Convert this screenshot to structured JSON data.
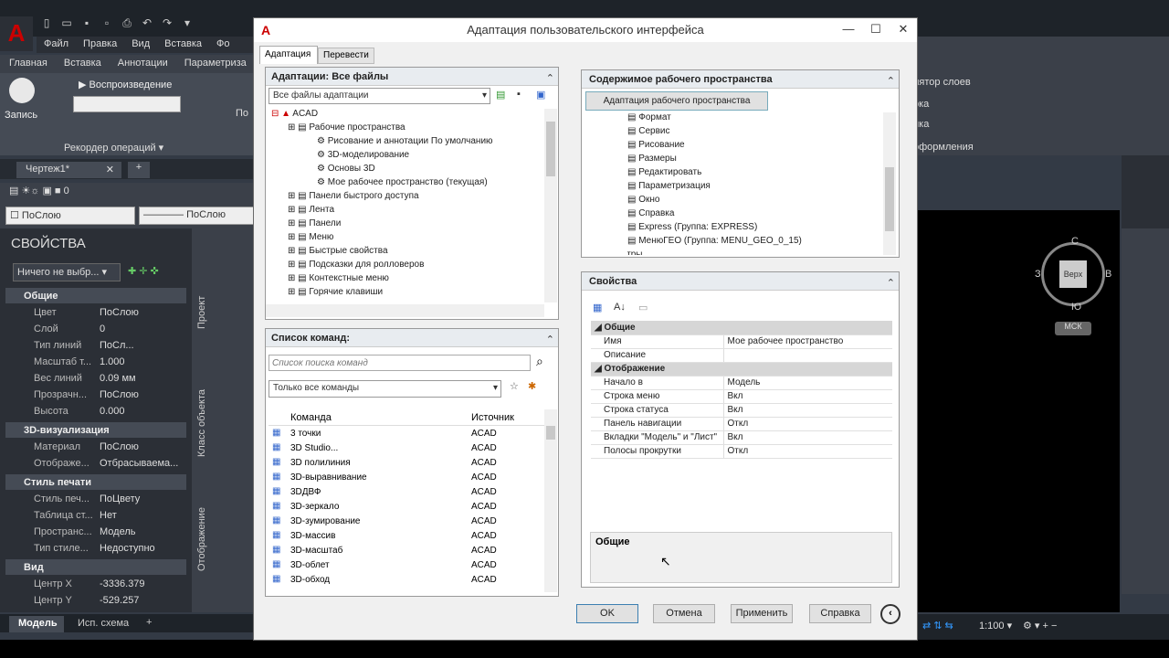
{
  "acad": {
    "menu": [
      "Файл",
      "Правка",
      "Вид",
      "Вставка",
      "Фо"
    ],
    "ribbon_tabs": [
      "Главная",
      "Вставка",
      "Аннотации",
      "Параметриза"
    ],
    "record_label": "Запись",
    "playback": "Воспроизведение",
    "recorder_panel": "Рекордер операций",
    "ribbon_side": "По",
    "doc_tab": "Чертеж1*",
    "layer_value": "0",
    "bylayer1": "ПоСлою",
    "bylayer2": "ПоСлою",
    "properties_title": "СВОЙСТВА",
    "selection": "Ничего не выбр...",
    "sections": {
      "general": "Общие",
      "viz3d": "3D-визуализация",
      "plotstyle": "Стиль печати",
      "view": "Вид"
    },
    "general_rows": [
      {
        "k": "Цвет",
        "v": "ПоСлою"
      },
      {
        "k": "Слой",
        "v": "0"
      },
      {
        "k": "Тип линий",
        "v": "ПоСл..."
      },
      {
        "k": "Масштаб т...",
        "v": "1.000"
      },
      {
        "k": "Вес линий",
        "v": "0.09 мм"
      },
      {
        "k": "Прозрачн...",
        "v": "ПоСлою"
      },
      {
        "k": "Высота",
        "v": "0.000"
      }
    ],
    "viz_rows": [
      {
        "k": "Материал",
        "v": "ПоСлою"
      },
      {
        "k": "Отображе...",
        "v": "Отбрасываема..."
      }
    ],
    "plot_rows": [
      {
        "k": "Стиль печ...",
        "v": "ПоЦвету"
      },
      {
        "k": "Таблица ст...",
        "v": "Нет"
      },
      {
        "k": "Прострaнс...",
        "v": "Модель"
      },
      {
        "k": "Тип стиле...",
        "v": "Недоступно"
      }
    ],
    "view_rows": [
      {
        "k": "Центр X",
        "v": "-3336.379"
      },
      {
        "k": "Центр Y",
        "v": "-529.257"
      }
    ],
    "side_labels": [
      "Проект",
      "Класс объекта",
      "Отображение"
    ],
    "status_tabs": [
      "Модель",
      "Исп. схема"
    ],
    "right_menu": [
      "лятор слоев",
      "рка",
      "йка",
      "оформления"
    ],
    "viewcube": {
      "top": "Верх",
      "n": "С",
      "s": "Ю",
      "w": "З",
      "e": "В",
      "ucs": "МСК"
    },
    "scale": "1:100"
  },
  "dialog": {
    "title": "Адаптация пользовательского интерфейса",
    "tabs": [
      "Адаптация",
      "Перевести"
    ],
    "left_top": {
      "header": "Адаптации: Все файлы",
      "combo": "Все файлы адаптации",
      "tree": [
        {
          "lvl": 0,
          "text": "ACAD"
        },
        {
          "lvl": 1,
          "text": "Рабочие пространства"
        },
        {
          "lvl": 2,
          "text": "Рисование и аннотации По умолчанию"
        },
        {
          "lvl": 2,
          "text": "3D-моделирование"
        },
        {
          "lvl": 2,
          "text": "Основы 3D"
        },
        {
          "lvl": 2,
          "text": "Мое рабочее пространство (текущая)"
        },
        {
          "lvl": 1,
          "text": "Панели быстрого доступа"
        },
        {
          "lvl": 1,
          "text": "Лента"
        },
        {
          "lvl": 1,
          "text": "Панели"
        },
        {
          "lvl": 1,
          "text": "Меню"
        },
        {
          "lvl": 1,
          "text": "Быстрые свойства"
        },
        {
          "lvl": 1,
          "text": "Подсказки для ролловеров"
        },
        {
          "lvl": 1,
          "text": "Контекстные меню"
        },
        {
          "lvl": 1,
          "text": "Горячие клавиши"
        }
      ]
    },
    "commands": {
      "header": "Список команд:",
      "search_placeholder": "Список поиска команд",
      "filter": "Только все команды",
      "col_cmd": "Команда",
      "col_src": "Источник",
      "rows": [
        {
          "c": "3 точки",
          "s": "ACAD"
        },
        {
          "c": "3D Studio...",
          "s": "ACAD"
        },
        {
          "c": "3D полилиния",
          "s": "ACAD"
        },
        {
          "c": "3D-выравнивание",
          "s": "ACAD"
        },
        {
          "c": "3DДВФ",
          "s": "ACAD"
        },
        {
          "c": "3D-зеркало",
          "s": "ACAD"
        },
        {
          "c": "3D-зумирование",
          "s": "ACAD"
        },
        {
          "c": "3D-массив",
          "s": "ACAD"
        },
        {
          "c": "3D-масштаб",
          "s": "ACAD"
        },
        {
          "c": "3D-облет",
          "s": "ACAD"
        },
        {
          "c": "3D-обход",
          "s": "ACAD"
        }
      ]
    },
    "workspace": {
      "header": "Содержимое рабочего пространства",
      "button": "Адаптация рабочего пространства",
      "items": [
        "Формат",
        "Сервис",
        "Рисование",
        "Размеры",
        "Редактировать",
        "Параметризация",
        "Окно",
        "Справка",
        "Express (Группа: EXPRESS)",
        "МенюГЕО (Группа: MENU_GEO_0_15)"
      ],
      "partial": "Палитры"
    },
    "properties": {
      "header": "Свойства",
      "cat_general": "Общие",
      "cat_display": "Отображение",
      "rows_general": [
        {
          "k": "Имя",
          "v": "Мое рабочее пространство"
        },
        {
          "k": "Описание",
          "v": ""
        }
      ],
      "rows_display": [
        {
          "k": "Начало в",
          "v": "Модель"
        },
        {
          "k": "Строка меню",
          "v": "Вкл"
        },
        {
          "k": "Строка статуса",
          "v": "Вкл"
        },
        {
          "k": "Панель навигации",
          "v": "Откл"
        },
        {
          "k": "Вкладки \"Модель\" и \"Лист\"",
          "v": "Вкл"
        },
        {
          "k": "Полосы прокрутки",
          "v": "Откл"
        }
      ],
      "desc_title": "Общие"
    },
    "buttons": {
      "ok": "OK",
      "cancel": "Отмена",
      "apply": "Применить",
      "help": "Справка"
    }
  }
}
